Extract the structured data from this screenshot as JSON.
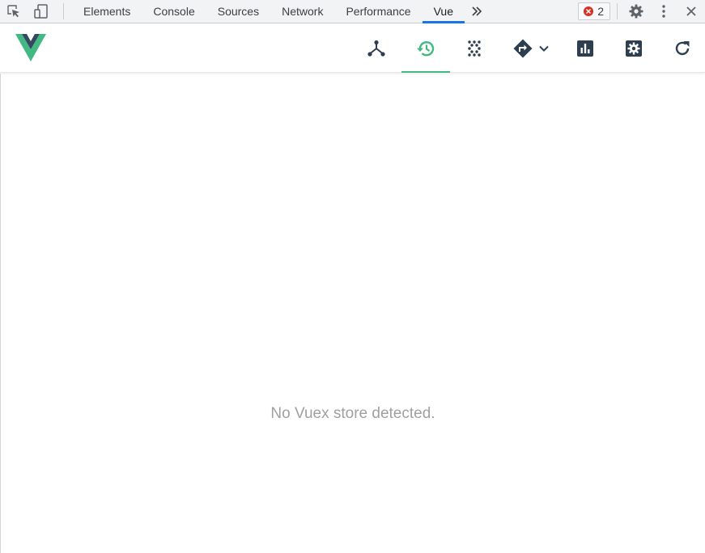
{
  "devtools": {
    "tabs": [
      {
        "label": "Elements"
      },
      {
        "label": "Console"
      },
      {
        "label": "Sources"
      },
      {
        "label": "Network"
      },
      {
        "label": "Performance"
      },
      {
        "label": "Vue",
        "active": true
      }
    ],
    "more_icon": "chevron-double-right-icon",
    "error_count": "2",
    "icons": {
      "inspect": "inspect-element-icon",
      "device": "device-toggle-icon",
      "settings": "gear-icon",
      "menu": "kebab-menu-icon",
      "close": "close-icon"
    },
    "accent_color": "#1a73e8",
    "error_color": "#d93025"
  },
  "vue_toolbar": {
    "logo": "vue-logo",
    "buttons": [
      {
        "name": "components",
        "icon": "component-tree-icon"
      },
      {
        "name": "vuex",
        "icon": "history-icon",
        "active": true
      },
      {
        "name": "events",
        "icon": "events-icon"
      },
      {
        "name": "routing",
        "icon": "routing-icon"
      },
      {
        "name": "performance",
        "icon": "bar-chart-icon"
      },
      {
        "name": "settings",
        "icon": "settings-icon"
      },
      {
        "name": "refresh",
        "icon": "refresh-icon"
      }
    ],
    "accent_color": "#42b983",
    "icon_color": "#2c3e50"
  },
  "main": {
    "empty_message": "No Vuex store detected."
  }
}
